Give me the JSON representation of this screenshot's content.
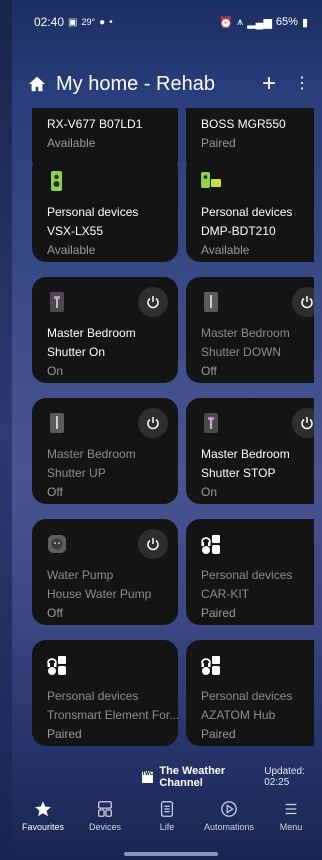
{
  "status": {
    "time": "02:40",
    "temp": "29°",
    "right_text": "65%"
  },
  "header": {
    "title": "My home - Rehab"
  },
  "cards": [
    {
      "line1": "RX-V677 B07LD1",
      "line2": "Available",
      "line3": ""
    },
    {
      "line1": "BOSS MGR550",
      "line2": "Paired",
      "line3": ""
    },
    {
      "line1": "Personal devices",
      "line2": "VSX-LX55",
      "line3": "Available"
    },
    {
      "line1": "Personal devices",
      "line2": "DMP-BDT210",
      "line3": "Available"
    },
    {
      "line1": "Master Bedroom",
      "line2": "Shutter On",
      "line3": "On"
    },
    {
      "line1": "Master Bedroom",
      "line2": "Shutter DOWN",
      "line3": "Off"
    },
    {
      "line1": "Master Bedroom",
      "line2": "Shutter UP",
      "line3": "Off"
    },
    {
      "line1": "Master Bedroom",
      "line2": "Shutter STOP",
      "line3": "On"
    },
    {
      "line1": "Water Pump",
      "line2": "House Water Pump",
      "line3": "Off"
    },
    {
      "line1": "Personal devices",
      "line2": "CAR-KIT",
      "line3": "Paired"
    },
    {
      "line1": "Personal devices",
      "line2": "Tronsmart Element For...",
      "line3": "Paired"
    },
    {
      "line1": "Personal devices",
      "line2": "AZATOM Hub",
      "line3": "Paired"
    }
  ],
  "weather": {
    "logo_text": "The Weather Channel",
    "name": "The Weather Channel",
    "updated": "Updated: 02:25"
  },
  "nav": [
    {
      "label": "Favourites",
      "icon": "star-icon"
    },
    {
      "label": "Devices",
      "icon": "devices-icon"
    },
    {
      "label": "Life",
      "icon": "life-icon"
    },
    {
      "label": "Automations",
      "icon": "automations-icon"
    },
    {
      "label": "Menu",
      "icon": "menu-icon"
    }
  ],
  "colors": {
    "card_bg": "#141414",
    "accent_on": "#e57bf0"
  }
}
